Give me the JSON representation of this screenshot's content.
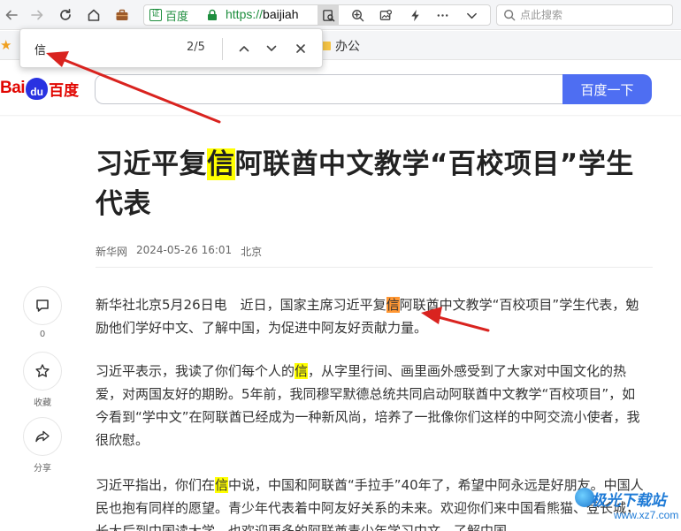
{
  "browser": {
    "url_verified_label": "百度",
    "url_verified_badge": "证",
    "url_scheme": "https://",
    "url_host": "baijiah",
    "search_placeholder": "点此搜索"
  },
  "bookmarks": {
    "items": [
      {
        "label": "办公"
      }
    ]
  },
  "findbar": {
    "query": "信",
    "count": "2/5"
  },
  "baidu": {
    "logo_latin": "Bai",
    "logo_paw": "du",
    "logo_cn": "百度",
    "search_button": "百度一下"
  },
  "article": {
    "title": {
      "before": "习近平复",
      "match": "信",
      "after": "阿联酋中文教学“百校项目”学生代表"
    },
    "source": "新华网",
    "datetime": "2024-05-26 16:01",
    "location": "北京",
    "p1": {
      "before": "新华社北京5月26日电　近日，国家主席习近平复",
      "match": "信",
      "after": "阿联酋中文教学“百校项目”学生代表，勉励他们学好中文、了解中国，为促进中阿友好贡献力量。"
    },
    "p2": {
      "before": "习近平表示，我读了你们每个人的",
      "match": "信",
      "after": "，从字里行间、画里画外感受到了大家对中国文化的热爱，对两国友好的期盼。5年前，我同穆罕默德总统共同启动阿联酋中文教学“百校项目”，如今看到“学中文”在阿联酋已经成为一种新风尚，培养了一批像你们这样的中阿交流小使者，我很欣慰。"
    },
    "p3": {
      "before": "习近平指出，你们在",
      "match": "信",
      "after": "中说，中国和阿联酋“手拉手”40年了，希望中阿永远是好朋友。中国人民也抱有同样的愿望。青少年代表着中阿友好关系的未来。欢迎你们来中国看熊猫、登长城，长大后到中国读大学。也欢迎更多的阿联酋青少年学习中文、了解中国"
    }
  },
  "side_actions": {
    "comment_count": "0",
    "favorite_label": "收藏",
    "share_label": "分享"
  },
  "watermark": {
    "text": "极光下载站",
    "url": "www.xz7.com"
  },
  "colors": {
    "baidu_blue": "#4e6ef2",
    "baidu_red": "#e10601",
    "match_highlight": "#ffff00",
    "active_match_highlight": "#ff9632",
    "annotation_arrow": "#d9231f"
  }
}
